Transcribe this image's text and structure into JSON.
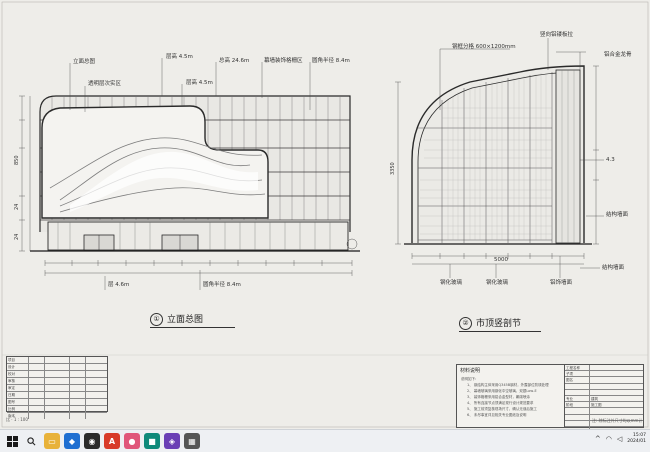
{
  "left_view": {
    "caption_number": "①",
    "caption_text": "立面总图",
    "callouts": [
      "立面总图",
      "透明层次实区",
      "层高 4.5m",
      "层高 4.5m",
      "总高 24.6m",
      "幕墙装饰格栅区",
      "圆角半径 8.4m"
    ],
    "bottom_labels": [
      "层 4.6m",
      "圆角半径 8.4m"
    ],
    "side_dims": [
      "850",
      "24",
      "24"
    ]
  },
  "right_view": {
    "caption_number": "②",
    "caption_text": "市顶竖剖节",
    "callouts_top": [
      "钢框分格 600×1200mm",
      "竖向铝镂板拉",
      "铝合金龙骨"
    ],
    "callouts_right": [
      "4.3",
      "结构墙面",
      "结构墙面"
    ],
    "bottom_labels": [
      "钢化玻璃",
      "钢化玻璃",
      "铝饰墙面"
    ],
    "side_dims": [
      "3350",
      "5000"
    ]
  },
  "notes": {
    "title": "材料说明",
    "subtitle": "说明如下:",
    "items": [
      "1、  钢结构主体采用Q345B钢材，外露部位防锈处理",
      "2、  幕墙玻璃采用钢化中空玻璃，双银Low-E",
      "3、  装饰格栅采用铝合金型材，氟碳喷涂",
      "4、  所有连接节点须满足现行设计规范要求",
      "5、  施工前须复核现场尺寸，确认无误后施工",
      "6、  未尽事宜详见相关专业图纸及说明"
    ]
  },
  "left_title_block": {
    "rows": [
      [
        "项目",
        "",
        "",
        "",
        ""
      ],
      [
        "设计",
        "",
        "",
        "",
        ""
      ],
      [
        "校对",
        "",
        "",
        "",
        ""
      ],
      [
        "审核",
        "",
        "",
        "",
        ""
      ],
      [
        "审定",
        "",
        "",
        "",
        ""
      ],
      [
        "日期",
        "",
        "",
        "",
        ""
      ],
      [
        "图号",
        "",
        "",
        "",
        ""
      ],
      [
        "比例",
        "",
        "",
        "",
        ""
      ],
      [
        "版本",
        "",
        "",
        "",
        ""
      ]
    ]
  },
  "right_title_block": {
    "rows": [
      [
        "工程名称",
        ""
      ],
      [
        "子项",
        ""
      ],
      [
        "图名",
        ""
      ],
      [
        "",
        ""
      ],
      [
        "",
        ""
      ],
      [
        "专业",
        "建筑"
      ],
      [
        "阶段",
        "施工图"
      ],
      [
        "",
        ""
      ],
      [
        "",
        ""
      ],
      [
        "",
        ""
      ],
      [
        "",
        ""
      ],
      [
        "",
        ""
      ]
    ]
  },
  "corner_notes": {
    "bottom_left": "比 ·  1 : 100",
    "bottom_right": "注: 除标注外尺寸均以mm计"
  },
  "taskbar": {
    "apps": [
      {
        "name": "file-explorer",
        "color": "#e8b23a",
        "glyph": "▭"
      },
      {
        "name": "app-blue",
        "color": "#1f6fd1",
        "glyph": "◆"
      },
      {
        "name": "app-dark",
        "color": "#2b2b2b",
        "glyph": "◉"
      },
      {
        "name": "app-red",
        "color": "#d83b2a",
        "glyph": "A"
      },
      {
        "name": "app-pink",
        "color": "#e0567a",
        "glyph": "●"
      },
      {
        "name": "app-teal",
        "color": "#0f8a7a",
        "glyph": "■"
      },
      {
        "name": "app-purple",
        "color": "#6a3fb5",
        "glyph": "◈"
      },
      {
        "name": "app-gray",
        "color": "#555555",
        "glyph": "▦"
      }
    ],
    "time": "15:07",
    "date": "2024/01"
  }
}
